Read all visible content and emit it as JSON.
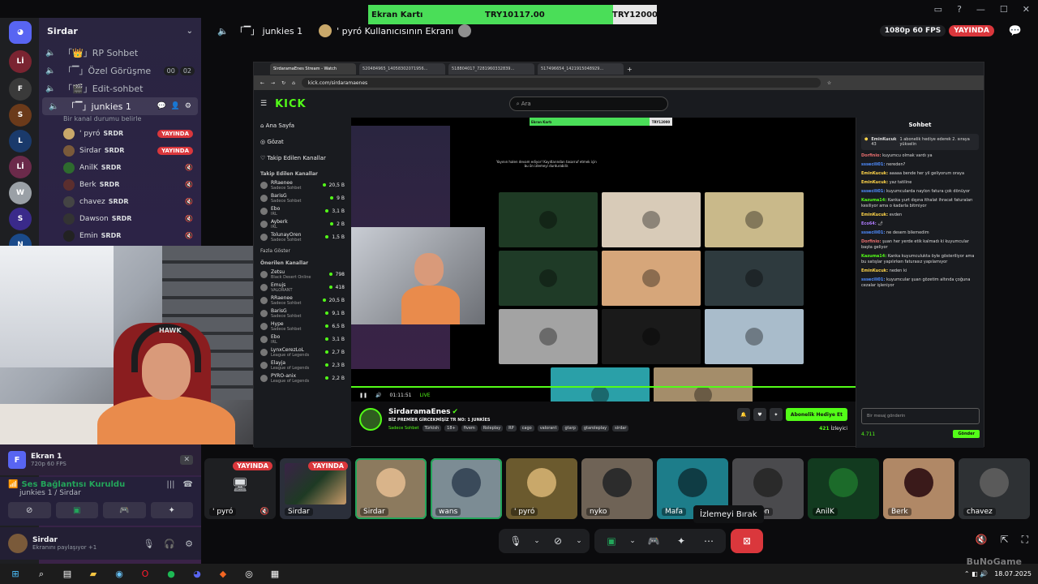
{
  "overlay": {
    "label": "Ekran Kartı",
    "current": "TRY10117.00",
    "target": "TRY12000",
    "progress": 0.843
  },
  "server": {
    "name": "Sirdar"
  },
  "channels": [
    {
      "name": "RP Sohbet",
      "prefix": "「👑」"
    },
    {
      "name": "Özel Görüşme",
      "prefix": "「▔」",
      "badge1": "00",
      "badge2": "02"
    },
    {
      "name": "Edit-sohbet",
      "prefix": "「🎬」"
    },
    {
      "name": "junkies 1",
      "prefix": "「▔」",
      "status": "Bir kanal durumu belirle"
    }
  ],
  "voice_users": [
    {
      "name": "' pyró",
      "tag": "SRDR",
      "live": "YAYINDA",
      "color": "#c9a86a"
    },
    {
      "name": "Sirdar",
      "tag": "SRDR",
      "live": "YAYINDA",
      "color": "#7a5a3a"
    },
    {
      "name": "AnilK",
      "tag": "SRDR",
      "color": "#2e6b2e"
    },
    {
      "name": "Berk",
      "tag": "SRDR",
      "color": "#5b2e2e"
    },
    {
      "name": "chavez",
      "tag": "SRDR",
      "color": "#444"
    },
    {
      "name": "Dawson",
      "tag": "SRDR",
      "color": "#333"
    },
    {
      "name": "Emin",
      "tag": "SRDR",
      "color": "#222"
    }
  ],
  "screen_panel": {
    "icon": "F",
    "title": "Ekran 1",
    "sub": "720p 60 FPS"
  },
  "voice_panel": {
    "title": "Ses Bağlantısı Kuruldu",
    "sub": "junkies 1 / Sirdar"
  },
  "account": {
    "name": "Sirdar",
    "status": "Ekranını paylaşıyor +1"
  },
  "topbar": {
    "channel": "「▔」 junkies 1",
    "user": "' pyró Kullanıcısının Ekranı",
    "quality": "1080p 60 FPS",
    "live": "YAYINDA"
  },
  "browser": {
    "tabs": [
      "SirdaramaEnes Stream - Watch",
      "520484965_14058302071956...",
      "518804017_7281960332839...",
      "517496654_1421915048929..."
    ],
    "url": "kick.com/sirdaramaenes",
    "search_placeholder": "Ara",
    "logo": "KICK",
    "nav": [
      "Ana Sayfa",
      "Gözat",
      "Takip Edilen Kanallar"
    ],
    "follow_header": "Takip Edilen Kanallar",
    "follows": [
      {
        "name": "RRaenee",
        "sub": "Sadece Sohbet",
        "viewers": "20,5 B"
      },
      {
        "name": "BarisG",
        "sub": "Sadece Sohbet",
        "viewers": "9 B"
      },
      {
        "name": "Ebo",
        "sub": "IRL",
        "viewers": "3,1 B"
      },
      {
        "name": "Ayberk",
        "sub": "IRL",
        "viewers": "2 B"
      },
      {
        "name": "TolunayOren",
        "sub": "Sadece Sohbet",
        "viewers": "1,5 B"
      }
    ],
    "show_more": "Fazla Göster",
    "rec_header": "Önerilen Kanallar",
    "recs": [
      {
        "name": "Zetsu",
        "sub": "Black Desert Online",
        "viewers": "798"
      },
      {
        "name": "Emujs",
        "sub": "VALORANT",
        "viewers": "418"
      },
      {
        "name": "RRaenee",
        "sub": "Sadece Sohbet",
        "viewers": "20,5 B"
      },
      {
        "name": "BarisG",
        "sub": "Sadece Sohbet",
        "viewers": "9,1 B"
      },
      {
        "name": "Hype",
        "sub": "Sadece Sohbet",
        "viewers": "6,5 B"
      },
      {
        "name": "Ebo",
        "sub": "IRL",
        "viewers": "3,1 B"
      },
      {
        "name": "LynxCerezLoL",
        "sub": "League of Legends",
        "viewers": "2,7 B"
      },
      {
        "name": "Elayja",
        "sub": "League of Legends",
        "viewers": "2,3 B"
      },
      {
        "name": "PYRO-anix",
        "sub": "League of Legends",
        "viewers": "2,2 B"
      }
    ],
    "video_msg": "Yayının halen devam ediyor! Kayıtlarından tasarruf etmek için bu ön izlemeyi durdurabilir.",
    "video_time": "01:11:51",
    "video_live": "LIVE",
    "streamer": "SirdaramaEnes",
    "stream_title": "BİZ PREMİER GİRCEKMİŞİZ TR NO: 1 JUNKİES",
    "category": "Sadece Sohbet",
    "tags": [
      "Türkish",
      "18+",
      "fivem",
      "Roleplay",
      "RP",
      "cago",
      "valorant",
      "gtarp",
      "gtaroleplay",
      "sirdar"
    ],
    "sub_button": "Abonelik Hediye Et",
    "viewers": "421",
    "viewers_label": "İzleyici",
    "chat_header": "Sohbet",
    "pinned_user": "EminKucuk",
    "pinned_count": "43",
    "pinned_text": "1 abonelik hediye ederek 2. sıraya yükselin",
    "chat_msgs": [
      {
        "u": "Dorfinio:",
        "t": "kuyumcu olmak vardı ya",
        "c": "#e86e6e"
      },
      {
        "u": "sssecili01:",
        "t": "nereden?",
        "c": "#4f8cff"
      },
      {
        "u": "EminKucuk:",
        "t": "aaaaa bende her yil geliyorum oraya",
        "c": "#ffd54a"
      },
      {
        "u": "EminKucuk:",
        "t": "yaz tatiline",
        "c": "#ffd54a"
      },
      {
        "u": "sssecili01:",
        "t": "kuyumcularda naylon fatura çok dönüyor",
        "c": "#4f8cff"
      },
      {
        "u": "Kazuma14:",
        "t": "Kanka yurt dışına ithalat ihracat faturaları kesiliyor ama o kadarla bitmiyor",
        "c": "#53fc18"
      },
      {
        "u": "EminKucuk:",
        "t": "evden",
        "c": "#ffd54a"
      },
      {
        "u": "Eco64:",
        "t": "🌶",
        "c": "#b07cff"
      },
      {
        "u": "sssecili01:",
        "t": "ne desem bilemedim",
        "c": "#4f8cff"
      },
      {
        "u": "Dorfinio:",
        "t": "şuan her yerde etik kalmadı ki kuyumcular başta geliyor",
        "c": "#e86e6e"
      },
      {
        "u": "Kazuma14:",
        "t": "Kanka kuyumculukta öyle gösteriliyor ama bu satışlar yapılırken faturasız yapılamıyor",
        "c": "#53fc18"
      },
      {
        "u": "EminKucuk:",
        "t": "neden ki",
        "c": "#ffd54a"
      },
      {
        "u": "sssecili01:",
        "t": "kuyumcular şuan gözetim altında çoğuna cezalar işleniyor",
        "c": "#4f8cff"
      }
    ],
    "chat_placeholder": "Bir mesaj gönderin",
    "points": "4.711",
    "send": "Gönder"
  },
  "tiles": [
    {
      "name": "' pyró",
      "live": "YAYINDA",
      "bg": "#1e1f22",
      "icon": "🖥"
    },
    {
      "name": "Sirdar",
      "live": "YAYINDA",
      "bg": "#2b2f3a"
    },
    {
      "name": "Sirdar",
      "bg": "#8c7a5e",
      "speaking": true,
      "av": "#d9b48a"
    },
    {
      "name": "wans",
      "bg": "#7c8c94",
      "speaking": true,
      "av": "#3a4a5a"
    },
    {
      "name": "' pyró",
      "bg": "#6b5a2e",
      "av": "#c9a86a"
    },
    {
      "name": "nyko",
      "bg": "#6f6356",
      "av": "#2c2c2c"
    },
    {
      "name": "Mafa",
      "bg": "#1d7d8a",
      "av": "#0f3c44"
    },
    {
      "name": "Dawson",
      "bg": "#4a4a4d",
      "av": "#2a2a2a"
    },
    {
      "name": "AnilK",
      "bg": "#123a1f",
      "av": "#1c6b2a"
    },
    {
      "name": "Berk",
      "bg": "#b08866",
      "av": "#3a1a1a"
    },
    {
      "name": "chavez",
      "bg": "#2e3134",
      "av": "#5a5a5a"
    }
  ],
  "tooltip": "İzlemeyi Bırak",
  "taskbar": {
    "date": "18.07.2025"
  },
  "watermark": "BuNoGame"
}
